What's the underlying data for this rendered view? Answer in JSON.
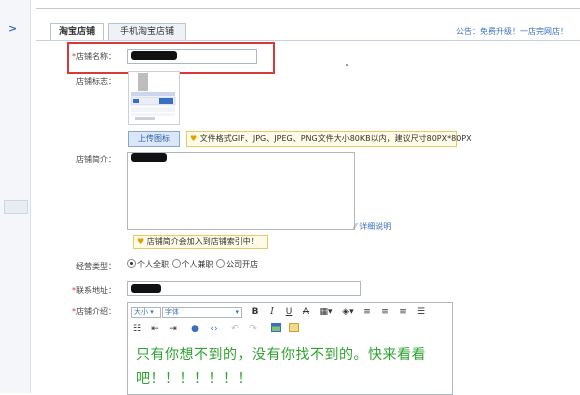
{
  "tabs": {
    "taobao": "淘宝店铺",
    "mobile": "手机淘宝店铺"
  },
  "notice": "公告：免费升级！一店完网店！",
  "form": {
    "shop_name_label": "店铺名称：",
    "shop_logo_label": "店铺标志：",
    "upload_button": "上传图标",
    "upload_tip": "文件格式GIF、JPG、JPEG、PNG文件大小80KB以内，建议尺寸80PX*80PX",
    "shop_intro_label": "店铺简介：",
    "detail_link": "详细说明",
    "intro_tip": "店铺简介会加入到店铺索引中！",
    "business_type_label": "经营类型：",
    "business_options": [
      "个人全职",
      "个人兼职",
      "公司开店"
    ],
    "business_selected": 0,
    "address_label": "联系地址：",
    "shop_desc_label": "店铺介绍：",
    "required_mark": "*"
  },
  "editor": {
    "size_select": "大小",
    "font_select": "字体",
    "bold": "B",
    "italic": "I",
    "underline": "U",
    "strike": "A",
    "content": "只有你想不到的，没有你找不到的。快来看看吧！！！！！！！"
  },
  "left_bar": {
    "toggle_glyph": ">"
  },
  "colors": {
    "highlight_border": "#d63a3a",
    "link": "#3a6fc0",
    "editor_text": "#2ea32e"
  }
}
